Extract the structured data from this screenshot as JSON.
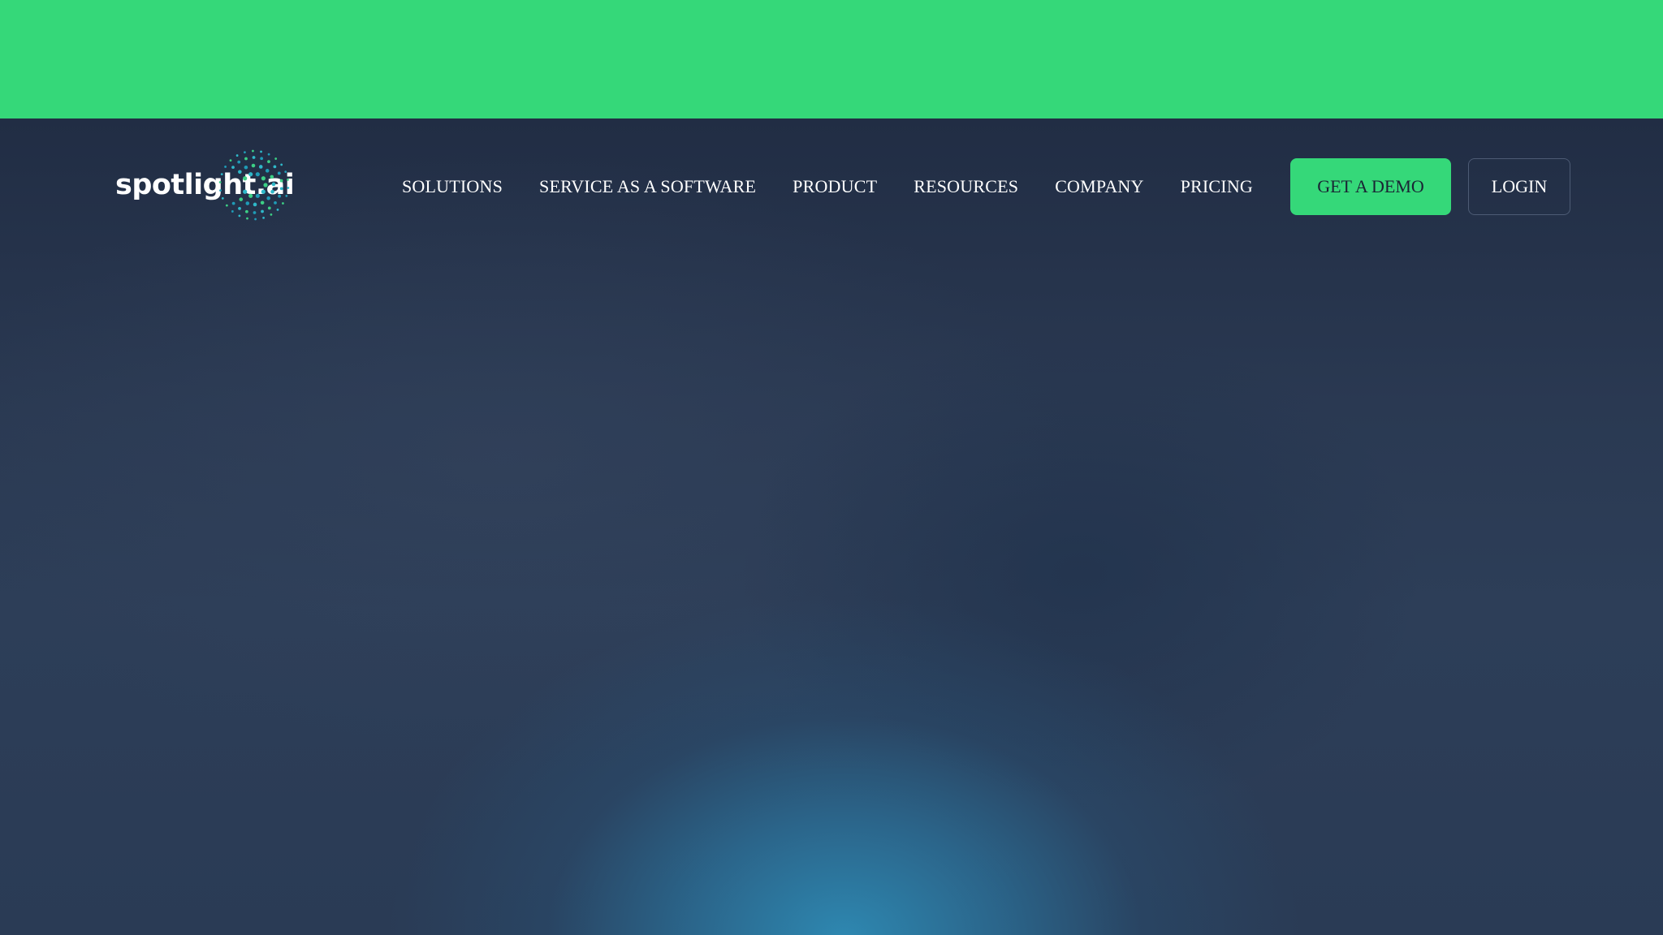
{
  "banner": {
    "color": "#35d879"
  },
  "logo": {
    "text": "spotlight.ai",
    "icon": "spotlight-burst-icon",
    "accent_colors": [
      "#3ccf85",
      "#2fb8c9",
      "#1f9bb6"
    ]
  },
  "nav": {
    "items": [
      {
        "label": "SOLUTIONS"
      },
      {
        "label": "SERVICE AS A SOFTWARE"
      },
      {
        "label": "PRODUCT"
      },
      {
        "label": "RESOURCES"
      },
      {
        "label": "COMPANY"
      },
      {
        "label": "PRICING"
      }
    ]
  },
  "actions": {
    "demo_label": "GET A DEMO",
    "login_label": "LOGIN"
  },
  "colors": {
    "accent": "#35d879",
    "background": "#27354d",
    "glow": "#2e8cb6"
  }
}
